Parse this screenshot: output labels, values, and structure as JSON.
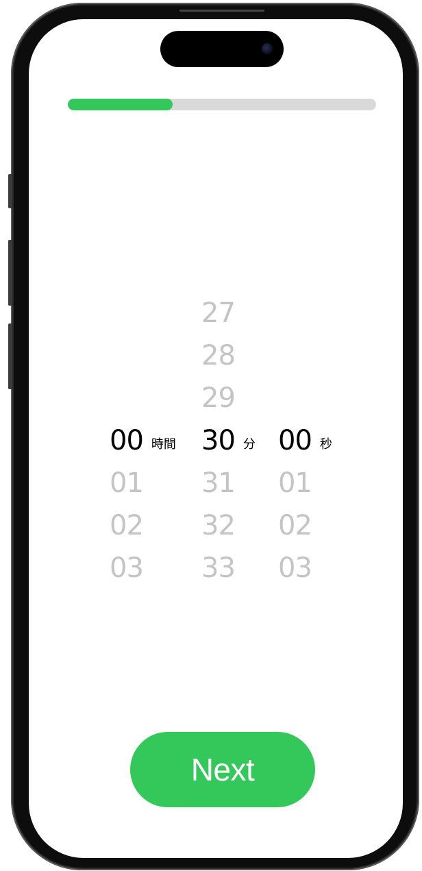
{
  "progress": {
    "value": 0.34,
    "color": "#34c759",
    "track_color": "#d9d9d9"
  },
  "picker": {
    "hours": {
      "above": [],
      "selected": "00",
      "below": [
        "01",
        "02",
        "03"
      ],
      "unit": "時間"
    },
    "minutes": {
      "above": [
        "27",
        "28",
        "29"
      ],
      "selected": "30",
      "below": [
        "31",
        "32",
        "33"
      ],
      "unit": "分"
    },
    "seconds": {
      "above": [],
      "selected": "00",
      "below": [
        "01",
        "02",
        "03"
      ],
      "unit": "秒"
    }
  },
  "next_button": {
    "label": "Next",
    "color": "#34c759"
  },
  "device": {
    "camera_icon": "front-camera-icon"
  }
}
